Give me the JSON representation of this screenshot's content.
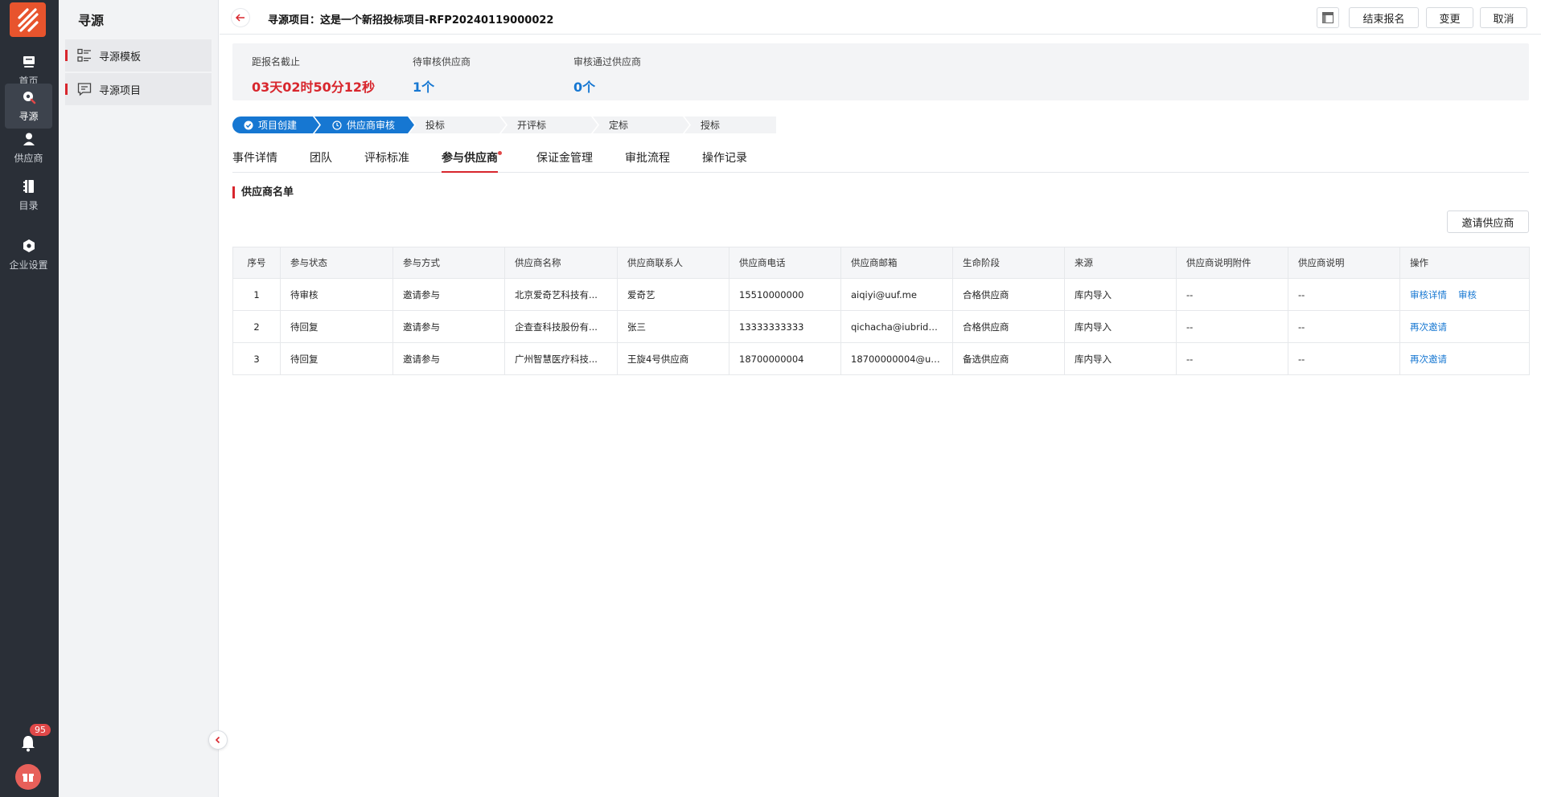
{
  "rail": {
    "items": [
      {
        "label": "首页",
        "icon": "home-icon"
      },
      {
        "label": "寻源",
        "icon": "sourcing-icon"
      },
      {
        "label": "供应商",
        "icon": "supplier-icon"
      },
      {
        "label": "目录",
        "icon": "catalog-icon"
      },
      {
        "label": "企业设置",
        "icon": "settings-icon"
      }
    ],
    "notification_count": "95"
  },
  "sidebar": {
    "title": "寻源",
    "items": [
      {
        "label": "寻源模板",
        "icon": "list-icon"
      },
      {
        "label": "寻源项目",
        "icon": "comment-icon"
      }
    ]
  },
  "header": {
    "title": "寻源项目：这是一个新招投标项目-RFP20240119000022",
    "buttons": {
      "end": "结束报名",
      "change": "变更",
      "cancel": "取消"
    }
  },
  "stats": [
    {
      "label": "距报名截止",
      "value": "03天02时50分12秒",
      "color": "#d8262d"
    },
    {
      "label": "待审核供应商",
      "value": "1个",
      "color": "#1677d2"
    },
    {
      "label": "审核通过供应商",
      "value": "0个",
      "color": "#1677d2"
    }
  ],
  "steps": [
    "项目创建",
    "供应商审核",
    "投标",
    "开评标",
    "定标",
    "授标"
  ],
  "tabs": [
    "事件详情",
    "团队",
    "评标标准",
    "参与供应商",
    "保证金管理",
    "审批流程",
    "操作记录"
  ],
  "section_title": "供应商名单",
  "invite_button": "邀请供应商",
  "table": {
    "columns": [
      "序号",
      "参与状态",
      "参与方式",
      "供应商名称",
      "供应商联系人",
      "供应商电话",
      "供应商邮箱",
      "生命阶段",
      "来源",
      "供应商说明附件",
      "供应商说明",
      "操作"
    ],
    "rows": [
      {
        "no": "1",
        "status": "待审核",
        "mode": "邀请参与",
        "name": "北京爱奇艺科技有...",
        "contact": "爱奇艺",
        "phone": "15510000000",
        "email": "aiqiyi@uuf.me",
        "stage": "合格供应商",
        "source": "库内导入",
        "attach": "--",
        "note": "--",
        "actions": [
          "审核详情",
          "审核"
        ]
      },
      {
        "no": "2",
        "status": "待回复",
        "mode": "邀请参与",
        "name": "企查查科技股份有...",
        "contact": "张三",
        "phone": "13333333333",
        "email": "qichacha@iubridg...",
        "stage": "合格供应商",
        "source": "库内导入",
        "attach": "--",
        "note": "--",
        "actions": [
          "再次邀请"
        ]
      },
      {
        "no": "3",
        "status": "待回复",
        "mode": "邀请参与",
        "name": "广州智慧医疗科技...",
        "contact": "王旋4号供应商",
        "phone": "18700000004",
        "email": "18700000004@uuf...",
        "stage": "备选供应商",
        "source": "库内导入",
        "attach": "--",
        "note": "--",
        "actions": [
          "再次邀请"
        ]
      }
    ]
  },
  "colors": {
    "accent_red": "#d8262d",
    "primary_blue": "#1677d2",
    "rail_bg": "#2a2f37"
  }
}
